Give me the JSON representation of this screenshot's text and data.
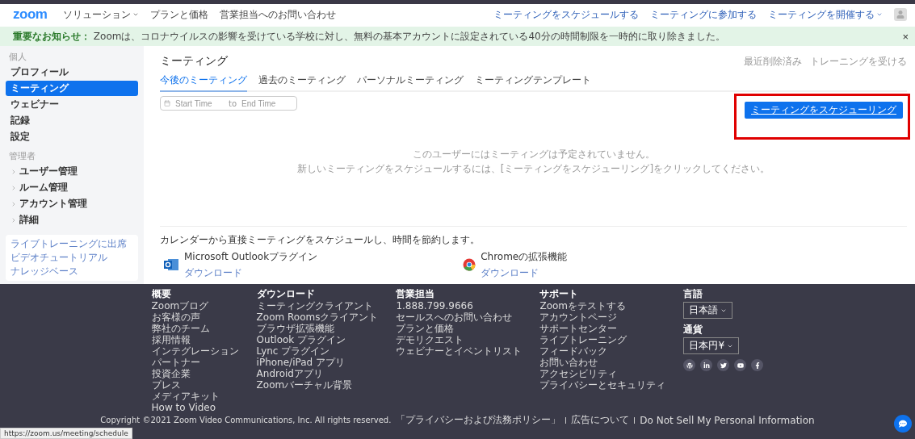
{
  "header": {
    "logo": "zoom",
    "nav": [
      {
        "label": "ソリューション",
        "dropdown": true
      },
      {
        "label": "プランと価格",
        "dropdown": false
      },
      {
        "label": "営業担当へのお問い合わせ",
        "dropdown": false
      }
    ],
    "actions": [
      {
        "label": "ミーティングをスケジュールする",
        "dropdown": false
      },
      {
        "label": "ミーティングに参加する",
        "dropdown": false
      },
      {
        "label": "ミーティングを開催する",
        "dropdown": true
      }
    ]
  },
  "notice": {
    "text": "**重要なお知らせ：** Zoomは、コロナウイルスの影響を受けている学校に対し、無料の基本アカウントに設定されている40分の時間制限を一時的に取り除きました。",
    "close": "×"
  },
  "sidebar": {
    "sections": [
      {
        "title": "個人",
        "items": [
          {
            "label": "プロフィール",
            "selected": false,
            "expandable": false
          },
          {
            "label": "ミーティング",
            "selected": true,
            "expandable": false
          },
          {
            "label": "ウェビナー",
            "selected": false,
            "expandable": false
          },
          {
            "label": "記録",
            "selected": false,
            "expandable": false
          },
          {
            "label": "設定",
            "selected": false,
            "expandable": false
          }
        ]
      },
      {
        "title": "管理者",
        "items": [
          {
            "label": "ユーザー管理",
            "selected": false,
            "expandable": true
          },
          {
            "label": "ルーム管理",
            "selected": false,
            "expandable": true
          },
          {
            "label": "アカウント管理",
            "selected": false,
            "expandable": true
          },
          {
            "label": "詳細",
            "selected": false,
            "expandable": true
          }
        ]
      }
    ],
    "links": [
      "ライブトレーニングに出席",
      "ビデオチュートリアル",
      "ナレッジベース"
    ]
  },
  "main": {
    "title": "ミーティング",
    "top_links": [
      "最近削除済み",
      "トレーニングを受ける"
    ],
    "tabs": [
      {
        "label": "今後のミーティング",
        "selected": true
      },
      {
        "label": "過去のミーティング",
        "selected": false
      },
      {
        "label": "パーソナルミーティング",
        "selected": false
      },
      {
        "label": "ミーティングテンプレート",
        "selected": false
      }
    ],
    "date_range": {
      "start_placeholder": "Start Time",
      "separator": "to",
      "end_placeholder": "End Time"
    },
    "schedule_button": {
      "label": "ミーティングをスケジューリング",
      "highlighted": true
    },
    "empty_message": [
      "このユーザーにはミーティングは予定されていません。",
      "新しいミーティングをスケジュールするには、[ミーティングをスケジューリング]をクリックしてください。"
    ],
    "calendar_note": "カレンダーから直接ミーティングをスケジュールし、時間を節約します。",
    "plugins": [
      {
        "kind": "outlook",
        "name": "Microsoft Outlookプラグイン",
        "link": "ダウンロード"
      },
      {
        "kind": "chrome",
        "name": "Chromeの拡張機能",
        "link": "ダウンロード"
      }
    ]
  },
  "footer": {
    "columns": [
      {
        "title": "概要",
        "items": [
          "Zoomブログ",
          "お客様の声",
          "弊社のチーム",
          "採用情報",
          "インテグレーション",
          "パートナー",
          "投資企業",
          "プレス",
          "メディアキット",
          "How to Video"
        ]
      },
      {
        "title": "ダウンロード",
        "items": [
          "ミーティングクライアント",
          "Zoom Roomsクライアント",
          "ブラウザ拡張機能",
          "Outlook プラグイン",
          "Lync プラグイン",
          "iPhone/iPad アプリ",
          "Androidアプリ",
          "Zoomバーチャル背景"
        ]
      },
      {
        "title": "営業担当",
        "items": [
          "1.888.799.9666",
          "セールスへのお問い合わせ",
          "プランと価格",
          "デモリクエスト",
          "ウェビナーとイベントリスト"
        ]
      },
      {
        "title": "サポート",
        "items": [
          "Zoomをテストする",
          "アカウントページ",
          "サポートセンター",
          "ライブトレーニング",
          "フィードバック",
          "お問い合わせ",
          "アクセシビリティ",
          "プライバシーとセキュリティ"
        ]
      }
    ],
    "selectors": [
      {
        "title": "言語",
        "value": "日本語"
      },
      {
        "title": "通貨",
        "value": "日本円¥"
      }
    ],
    "copyright": "Copyright ©2021 Zoom Video Communications, Inc. All rights reserved.",
    "legal_links": [
      "「プライバシーおよび法務ポリシー」",
      "広告について",
      "Do Not Sell My Personal Information"
    ]
  },
  "status_url": "https://zoom.us/meeting/schedule"
}
